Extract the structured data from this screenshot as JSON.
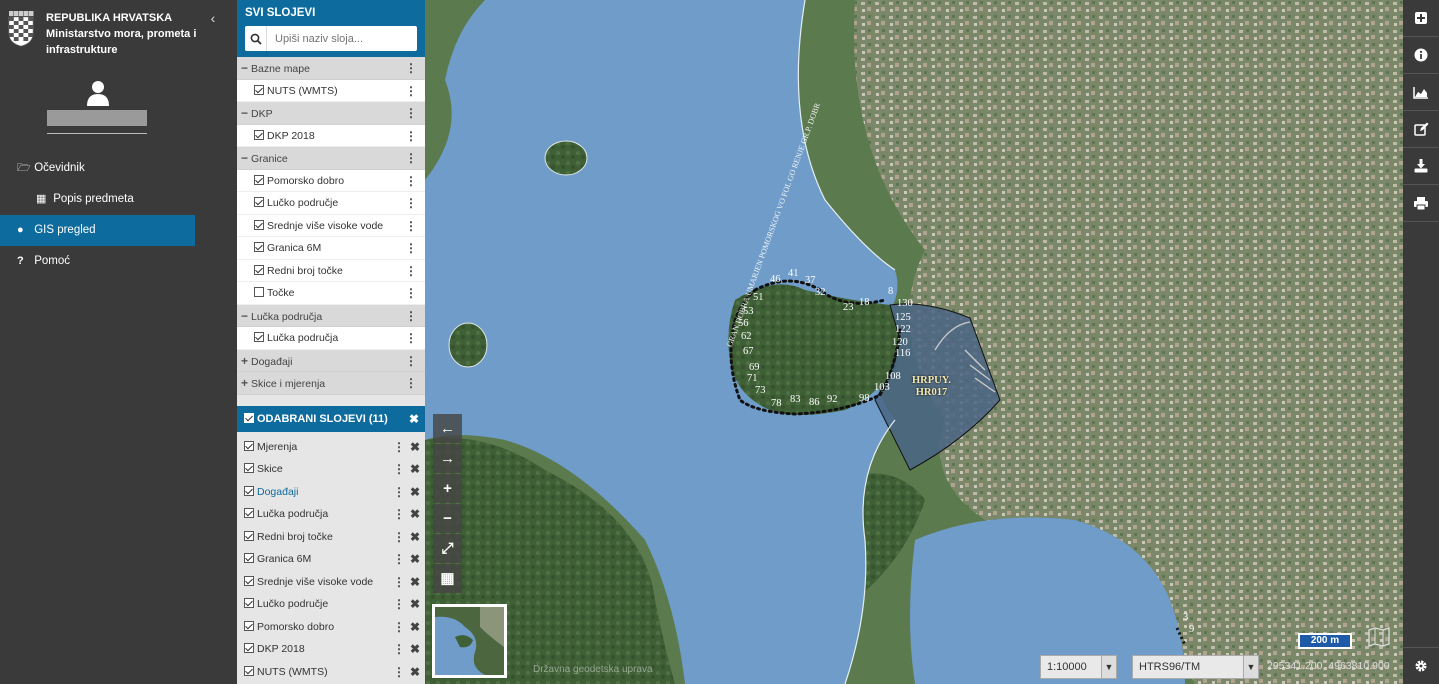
{
  "brand": {
    "line1": "REPUBLIKA HRVATSKA",
    "line2": "Ministarstvo mora, prometa i infrastrukture"
  },
  "nav": {
    "items": [
      {
        "label": "Očevidnik",
        "icon": "folder-open-icon"
      },
      {
        "label": "Popis predmeta",
        "icon": "table-icon"
      },
      {
        "label": "GIS pregled",
        "icon": "globe-icon",
        "active": true
      },
      {
        "label": "Pomoć",
        "icon": "question-icon"
      }
    ]
  },
  "layers": {
    "title": "SVI SLOJEVI",
    "search_placeholder": "Upiši naziv sloja...",
    "groups": [
      {
        "label": "Bazne mape",
        "expanded": true,
        "items": [
          {
            "label": "NUTS (WMTS)",
            "checked": true
          }
        ]
      },
      {
        "label": "DKP",
        "expanded": true,
        "items": [
          {
            "label": "DKP 2018",
            "checked": true
          }
        ]
      },
      {
        "label": "Granice",
        "expanded": true,
        "items": [
          {
            "label": "Pomorsko dobro",
            "checked": true
          },
          {
            "label": "Lučko područje",
            "checked": true
          },
          {
            "label": "Srednje više visoke vode",
            "checked": true
          },
          {
            "label": "Granica 6M",
            "checked": true
          },
          {
            "label": "Redni broj točke",
            "checked": true
          },
          {
            "label": "Točke",
            "checked": false
          }
        ]
      },
      {
        "label": "Lučka područja",
        "expanded": true,
        "items": [
          {
            "label": "Lučka područja",
            "checked": true
          }
        ]
      },
      {
        "label": "Događaji",
        "expanded": false,
        "items": []
      },
      {
        "label": "Skice i mjerenja",
        "expanded": false,
        "items": []
      }
    ]
  },
  "selected": {
    "title": "ODABRANI SLOJEVI (11)",
    "items": [
      {
        "label": "Mjerenja"
      },
      {
        "label": "Skice"
      },
      {
        "label": "Događaji",
        "link": true
      },
      {
        "label": "Lučka područja"
      },
      {
        "label": "Redni broj točke"
      },
      {
        "label": "Granica 6M"
      },
      {
        "label": "Srednje više visoke vode"
      },
      {
        "label": "Lučko područje"
      },
      {
        "label": "Pomorsko dobro"
      },
      {
        "label": "DKP 2018"
      },
      {
        "label": "NUTS (WMTS)"
      }
    ]
  },
  "map": {
    "port_label_1": "HRPUY.",
    "port_label_2": "HR017",
    "boundary_text": "GRAN DOBRA UMARJEN POMORSKOG VO FOL GO RENJE GR.P. DOBR",
    "point_numbers": [
      "46",
      "41",
      "37",
      "32",
      "23",
      "18",
      "8",
      "130",
      "125",
      "122",
      "120",
      "116",
      "108",
      "103",
      "98",
      "92",
      "86",
      "83",
      "78",
      "73",
      "71",
      "69",
      "67",
      "62",
      "56",
      "53",
      "51",
      "3",
      "9"
    ],
    "scale": "1:10000",
    "crs": "HTRS96/TM",
    "coordinates": "295341.200, 4963810.900",
    "scalebar": "200 m",
    "attribution": "Državna geodetska uprava",
    "water_color": "#6f9cc8",
    "land_color": "#5b7a4e",
    "port_fill": "#4a6585"
  },
  "controls": {
    "back": "←",
    "forward": "→",
    "zoom_in": "+",
    "zoom_out": "−",
    "fullscreen": "⤢",
    "grid": "▦"
  }
}
